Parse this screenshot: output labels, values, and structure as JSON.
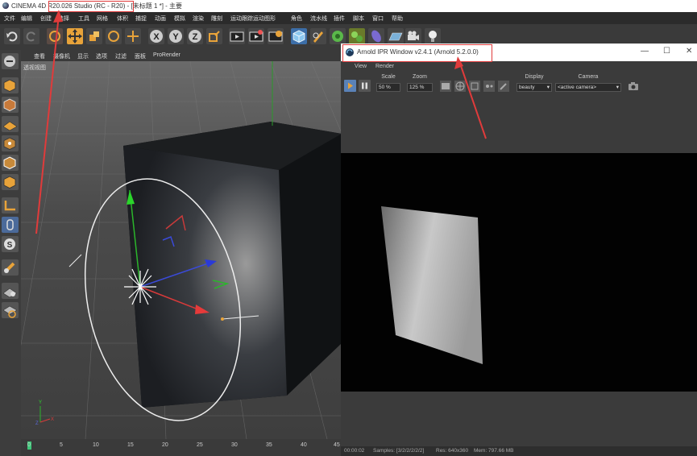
{
  "app": {
    "title": "CINEMA 4D R20.026 Studio (RC - R20) - [未标题 1 *] - 主要"
  },
  "menubar": [
    "文件",
    "编辑",
    "创建",
    "选择",
    "工具",
    "网格",
    "体积",
    "捕捉",
    "动画",
    "模拟",
    "渲染",
    "雕刻",
    "运动跟踪",
    "运动图形",
    "角色",
    "流水线",
    "插件",
    "脚本",
    "窗口",
    "帮助"
  ],
  "toolbar": {
    "icons": [
      "undo-icon",
      "redo-icon",
      "live-select-icon",
      "move-icon",
      "scale-icon",
      "rotate-icon",
      "recent-tool-icon",
      "x-axis-icon",
      "y-axis-icon",
      "z-axis-icon",
      "coordinate-system-icon",
      "render-view-icon",
      "render-picture-viewer-icon",
      "edit-render-settings-icon",
      "cube-icon",
      "pen-icon",
      "subdivision-icon",
      "array-icon",
      "deformer-icon",
      "floor-icon",
      "camera-icon",
      "light-icon"
    ],
    "axis_labels": [
      "X",
      "Y",
      "Z"
    ]
  },
  "left_tools": [
    "make-editable-icon",
    "model-mode-icon",
    "texture-mode-icon",
    "workplane-icon",
    "points-mode-icon",
    "edges-mode-icon",
    "polygons-mode-icon",
    "axis-mode-icon",
    "tweak-icon",
    "snap-icon",
    "enable-axis-icon",
    "solo-icon",
    "locked-workplane-icon"
  ],
  "viewport": {
    "label": "透视视图",
    "menu": [
      "查看",
      "摄像机",
      "显示",
      "选项",
      "过滤",
      "面板",
      "ProRender"
    ]
  },
  "timeline": {
    "ticks": [
      "0",
      "5",
      "10",
      "15",
      "20",
      "25",
      "30",
      "35",
      "40",
      "45"
    ]
  },
  "arnold": {
    "title": "Arnold IPR Window v2.4.1 (Arnold 5.2.0.0)",
    "menu": [
      "View",
      "Render"
    ],
    "scale_label": "Scale",
    "scale_value": "50 %",
    "zoom_label": "Zoom",
    "zoom_value": "125 %",
    "display_label": "Display",
    "display_value": "beauty",
    "camera_label": "Camera",
    "camera_value": "<active camera>",
    "status": {
      "time": "00:00:02",
      "samples": "Samples: [3/2/2/2/2/2]",
      "res": "Res: 640x360",
      "mem": "Mem: 797.66 MB"
    },
    "window_controls": [
      "—",
      "☐",
      "✕"
    ]
  },
  "colors": {
    "annotation_red": "#e03b3b",
    "active_orange": "#e8a33a",
    "bg_dark": "#333333"
  }
}
